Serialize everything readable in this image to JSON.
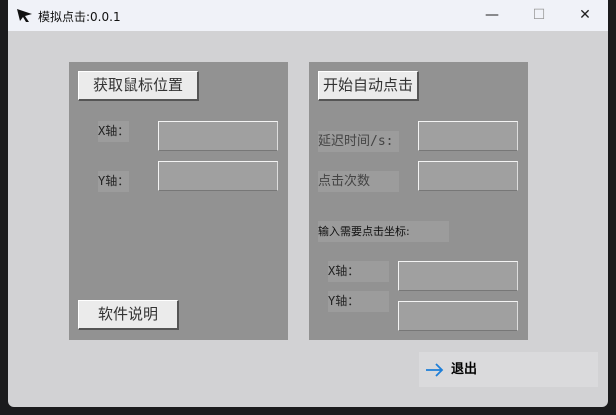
{
  "window": {
    "title": "模拟点击:0.0.1",
    "minimize": "—",
    "maximize": "☐",
    "close": "✕"
  },
  "left_panel": {
    "get_mouse_button": "获取鼠标位置",
    "x_label": "X轴：",
    "y_label": "Y轴：",
    "x_value": "",
    "y_value": "",
    "help_button": "软件说明"
  },
  "right_panel": {
    "start_button": "开始自动点击",
    "delay_label": "延迟时间/s:",
    "count_label": "点击次数",
    "coord_prompt": "输入需要点击坐标:",
    "x_label": "X轴：",
    "y_label": "Y轴：",
    "delay_value": "",
    "count_value": "",
    "x_value": "",
    "y_value": ""
  },
  "exit_button": {
    "label": "退出",
    "icon": "arrow-right-icon"
  }
}
